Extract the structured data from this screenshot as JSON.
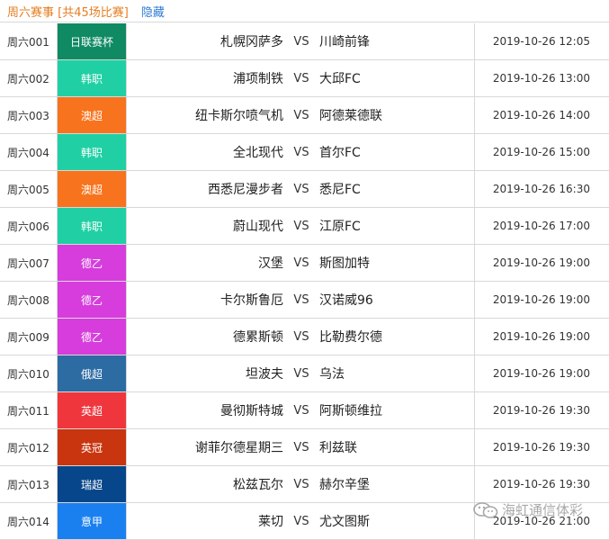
{
  "header": {
    "title": "周六赛事 [共45场比赛]",
    "hide_label": "隐藏"
  },
  "vs_label": "VS",
  "matches": [
    {
      "id": "周六001",
      "league": "日联赛杯",
      "league_color": "#0f8a63",
      "home": "札幌冈萨多",
      "away": "川崎前锋",
      "time": "2019-10-26 12:05"
    },
    {
      "id": "周六002",
      "league": "韩职",
      "league_color": "#20d0a4",
      "home": "浦项制铁",
      "away": "大邱FC",
      "time": "2019-10-26 13:00"
    },
    {
      "id": "周六003",
      "league": "澳超",
      "league_color": "#f8731d",
      "home": "纽卡斯尔喷气机",
      "away": "阿德莱德联",
      "time": "2019-10-26 14:00"
    },
    {
      "id": "周六004",
      "league": "韩职",
      "league_color": "#20d0a4",
      "home": "全北现代",
      "away": "首尔FC",
      "time": "2019-10-26 15:00"
    },
    {
      "id": "周六005",
      "league": "澳超",
      "league_color": "#f8731d",
      "home": "西悉尼漫步者",
      "away": "悉尼FC",
      "time": "2019-10-26 16:30"
    },
    {
      "id": "周六006",
      "league": "韩职",
      "league_color": "#20d0a4",
      "home": "蔚山现代",
      "away": "江原FC",
      "time": "2019-10-26 17:00"
    },
    {
      "id": "周六007",
      "league": "德乙",
      "league_color": "#d63ddc",
      "home": "汉堡",
      "away": "斯图加特",
      "time": "2019-10-26 19:00"
    },
    {
      "id": "周六008",
      "league": "德乙",
      "league_color": "#d63ddc",
      "home": "卡尔斯鲁厄",
      "away": "汉诺威96",
      "time": "2019-10-26 19:00"
    },
    {
      "id": "周六009",
      "league": "德乙",
      "league_color": "#d63ddc",
      "home": "德累斯顿",
      "away": "比勒费尔德",
      "time": "2019-10-26 19:00"
    },
    {
      "id": "周六010",
      "league": "俄超",
      "league_color": "#2d6ba3",
      "home": "坦波夫",
      "away": "乌法",
      "time": "2019-10-26 19:00"
    },
    {
      "id": "周六011",
      "league": "英超",
      "league_color": "#f0363d",
      "home": "曼彻斯特城",
      "away": "阿斯顿维拉",
      "time": "2019-10-26 19:30"
    },
    {
      "id": "周六012",
      "league": "英冠",
      "league_color": "#c9350f",
      "home": "谢菲尔德星期三",
      "away": "利兹联",
      "time": "2019-10-26 19:30"
    },
    {
      "id": "周六013",
      "league": "瑞超",
      "league_color": "#07468a",
      "home": "松兹瓦尔",
      "away": "赫尔辛堡",
      "time": "2019-10-26 19:30"
    },
    {
      "id": "周六014",
      "league": "意甲",
      "league_color": "#1a80f0",
      "home": "莱切",
      "away": "尤文图斯",
      "time": "2019-10-26 21:00"
    }
  ],
  "watermark": {
    "icon": "wechat-icon",
    "text": "海虹通信体彩"
  }
}
